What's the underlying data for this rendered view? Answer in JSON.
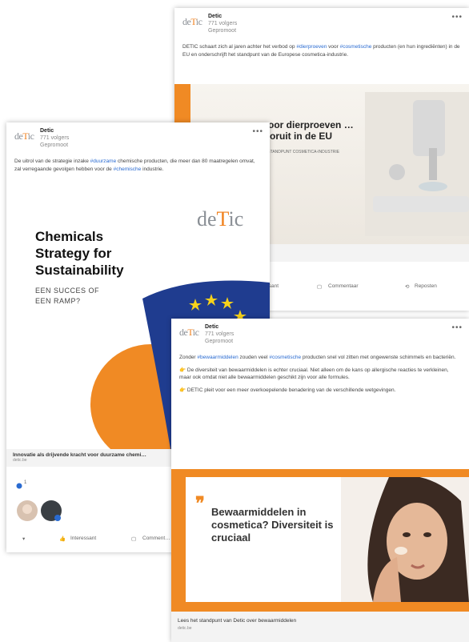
{
  "back_post": {
    "author": "Detic",
    "followers": "771 volgers",
    "status": "Gepromoot",
    "text_parts": [
      "DETIC schaart zich al jaren achter het verbod op ",
      "#dierproeven",
      " voor ",
      "#cosmetische",
      " producten (en hun ingrediënten) in de EU en onderschrijft het standpunt van de Europese cosmetica-industrie."
    ],
    "image_title": "…oor dierproeven …vooruit in de EU",
    "image_sub": "HET STANDPUNT COSMETICA-INDUSTRIE",
    "caption": "…Industrie",
    "actions": [
      "…ssant",
      "Commentaar",
      "Reposten"
    ]
  },
  "left_post": {
    "author": "Detic",
    "followers": "771 volgers",
    "status": "Gepromoot",
    "text_parts": [
      "De uitrol van de strategie inzake ",
      "#duurzame",
      " chemische producten, die meer dan 80 maatregelen omvat, zal verregaande gevolgen hebben voor de ",
      "#chemische",
      " industrie."
    ],
    "image_title": "Chemicals Strategy for Sustainability",
    "image_sub": "EEN SUCCES OF EEN RAMP?",
    "logo": "deTic",
    "caption": "Innovatie als drijvende kracht voor duurzame chemi…",
    "caption_sub": "detic.be",
    "reaction_count": "1",
    "actions": [
      "Interessant",
      "Comment…"
    ]
  },
  "front_post": {
    "author": "Detic",
    "followers": "771 volgers",
    "status": "Gepromoot",
    "para1_parts": [
      "Zonder ",
      "#bewaarmiddelen",
      " zouden veel ",
      "#cosmetische",
      " producten snel vol zitten met ongewenste schimmels en bacteriën."
    ],
    "para2": "De diversiteit van bewaarmiddelen is echter cruciaal. Niet alleen om de kans op allergische reacties te verkleinen, maar ook omdat niet alle bewaarmiddelen geschikt zijn voor alle formules.",
    "para3": "DETIC pleit voor een meer overkoepelende benadering van de verschillende wetgevingen.",
    "image_title": "Bewaarmiddelen in cosmetica? Diversiteit is cruciaal",
    "caption": "Lees het standpunt van Detic over bewaarmiddelen",
    "caption_sub": "detic.be"
  },
  "colors": {
    "brand_orange": "#f08a24",
    "hashtag_blue": "#2a6bd1",
    "eu_blue": "#1f3c8f",
    "eu_star": "#f6d21b"
  },
  "icons": [
    "more-icon",
    "like-icon",
    "comment-icon",
    "repost-icon"
  ]
}
